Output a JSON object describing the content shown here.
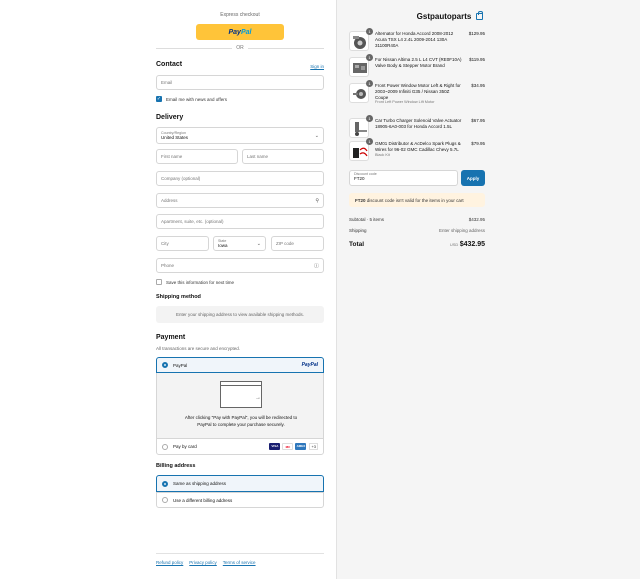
{
  "express": {
    "label": "Express checkout",
    "paypal_a": "Pay",
    "paypal_b": "Pal",
    "or": "OR"
  },
  "contact": {
    "title": "Contact",
    "signin": "Sign in",
    "email_placeholder": "Email",
    "news_label": "Email me with news and offers"
  },
  "delivery": {
    "title": "Delivery",
    "country_label": "Country/Region",
    "country_value": "United States",
    "first_name": "First name",
    "last_name": "Last name",
    "company": "Company (optional)",
    "address": "Address",
    "apartment": "Apartment, suite, etc. (optional)",
    "city": "City",
    "state_label": "State",
    "state_value": "Iowa",
    "zip": "ZIP code",
    "phone": "Phone",
    "save_info": "Save this information for next time"
  },
  "shipping_method": {
    "title": "Shipping method",
    "notice": "Enter your shipping address to view available shipping methods."
  },
  "payment": {
    "title": "Payment",
    "subtitle": "All transactions are secure and encrypted.",
    "paypal_label": "PayPal",
    "paypal_logo": "PayPal",
    "redirect_text_1": "After clicking \"Pay with PayPal\", you will be redirected to",
    "redirect_text_2": "PayPal to complete your purchase securely.",
    "card_label": "Pay by card",
    "card_more": "+3",
    "card_badges": [
      {
        "name": "VISA",
        "color": "#1a1f71"
      },
      {
        "name": "MC",
        "color": "#eb001b"
      },
      {
        "name": "AMEX",
        "color": "#2e77bc"
      }
    ]
  },
  "billing": {
    "title": "Billing address",
    "same": "Same as shipping address",
    "different": "Use a different billing address"
  },
  "footer": {
    "refund": "Refund policy",
    "privacy": "Privacy policy",
    "terms": "Terms of service"
  },
  "cart": {
    "store_name": "Gstpautoparts",
    "items": [
      {
        "qty": "1",
        "name": "Alternator for Honda Accord 2008-2012 Acura TSX L4 2.4L 2009-2014 130A 31100R40A",
        "variant": "",
        "price": "$129.95"
      },
      {
        "qty": "1",
        "name": "For Nissan Altima 2.5 L L4 CVT (RE0F10A) Valve Body & Stepper Motor Brand",
        "variant": "",
        "price": "$119.95"
      },
      {
        "qty": "1",
        "name": "Front Power Window Motor Left & Right for 2003~2009 Infiniti G35 / Nissan 350Z Coupe",
        "variant": "Front Left Power Window Lift Motor",
        "price": "$34.95"
      },
      {
        "qty": "1",
        "name": "Car Turbo Charger Solenoid Valve Actuator 18905-6A0-003 for Honda Accord 1.5L",
        "variant": "",
        "price": "$67.95"
      },
      {
        "qty": "1",
        "name": "GM01 Distributor & AcDelco Spark Plugs & Wires for 96-02 GMC Cadillac Chevy 5.7L",
        "variant": "Black Kit",
        "price": "$79.95"
      }
    ],
    "discount_label": "Discount code",
    "discount_value": "FT20",
    "apply": "Apply",
    "warning_code": "FT20",
    "warning_text": "discount code isn't valid for the items in your cart",
    "subtotal_label": "Subtotal · 5 items",
    "subtotal_value": "$432.95",
    "shipping_label": "Shipping",
    "shipping_value": "Enter shipping address",
    "total_label": "Total",
    "currency": "USD",
    "total_value": "$432.95"
  }
}
